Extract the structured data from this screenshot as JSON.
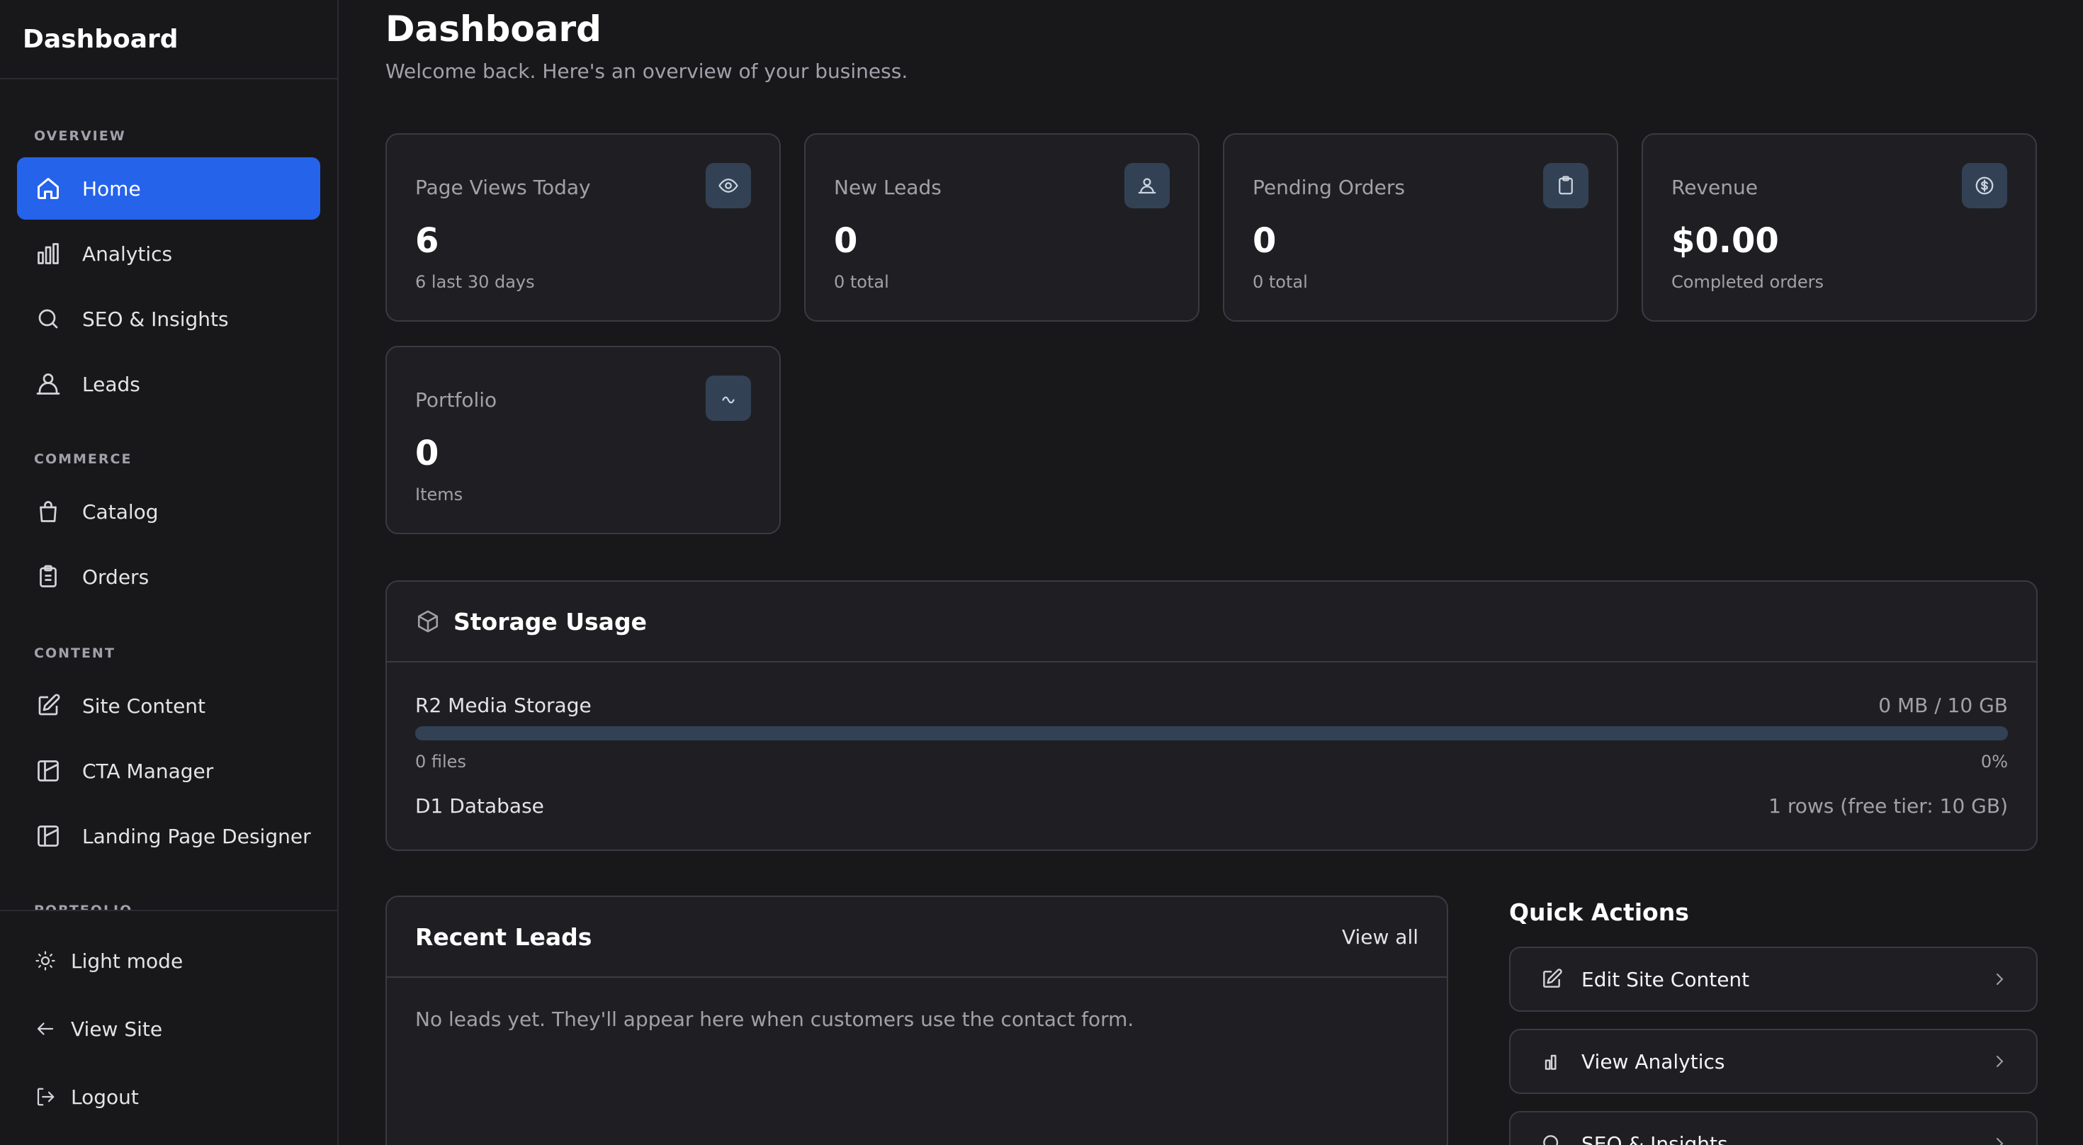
{
  "sidebar": {
    "brand": "Dashboard",
    "sections": [
      {
        "heading": "OVERVIEW",
        "items": [
          {
            "label": "Home",
            "icon": "home-icon",
            "active": true
          },
          {
            "label": "Analytics",
            "icon": "bar-chart-icon"
          },
          {
            "label": "SEO & Insights",
            "icon": "search-icon"
          },
          {
            "label": "Leads",
            "icon": "users-icon"
          }
        ]
      },
      {
        "heading": "COMMERCE",
        "items": [
          {
            "label": "Catalog",
            "icon": "shopping-bag-icon"
          },
          {
            "label": "Orders",
            "icon": "clipboard-icon"
          }
        ]
      },
      {
        "heading": "CONTENT",
        "items": [
          {
            "label": "Site Content",
            "icon": "edit-icon"
          },
          {
            "label": "CTA Manager",
            "icon": "layout-icon"
          },
          {
            "label": "Landing Page Designer",
            "icon": "layout-icon"
          }
        ]
      },
      {
        "heading": "PORTFOLIO"
      }
    ],
    "footer": {
      "light_mode": "Light mode",
      "view_site": "View Site",
      "logout": "Logout"
    }
  },
  "header": {
    "title": "Dashboard",
    "subtitle": "Welcome back. Here's an overview of your business."
  },
  "stats": [
    {
      "label": "Page Views Today",
      "value": "6",
      "sub": "6 last 30 days",
      "icon": "eye-icon"
    },
    {
      "label": "New Leads",
      "value": "0",
      "sub": "0 total",
      "icon": "users-icon"
    },
    {
      "label": "Pending Orders",
      "value": "0",
      "sub": "0 total",
      "icon": "clipboard-icon"
    },
    {
      "label": "Revenue",
      "value": "$0.00",
      "sub": "Completed orders",
      "icon": "dollar-icon"
    },
    {
      "label": "Portfolio",
      "value": "0",
      "sub": "Items",
      "icon": "wave-icon"
    }
  ],
  "storage": {
    "title": "Storage Usage",
    "r2_label": "R2 Media Storage",
    "r2_usage": "0 MB / 10 GB",
    "r2_files": "0 files",
    "r2_percent": "0%",
    "r2_fraction": 0,
    "d1_label": "D1 Database",
    "d1_usage": "1 rows (free tier: 10 GB)"
  },
  "recent_leads": {
    "title": "Recent Leads",
    "view_all": "View all",
    "empty": "No leads yet. They'll appear here when customers use the contact form."
  },
  "quick_actions": {
    "title": "Quick Actions",
    "items": [
      {
        "label": "Edit Site Content",
        "icon": "edit-icon"
      },
      {
        "label": "View Analytics",
        "icon": "bar-chart-icon"
      },
      {
        "label": "SEO & Insights",
        "icon": "search-icon"
      }
    ]
  },
  "colors": {
    "background": "#18181b",
    "card": "#1f1f23",
    "border": "#3a3a42",
    "accent": "#2563eb",
    "badge": "#334155",
    "muted_text": "#a1a1aa"
  }
}
